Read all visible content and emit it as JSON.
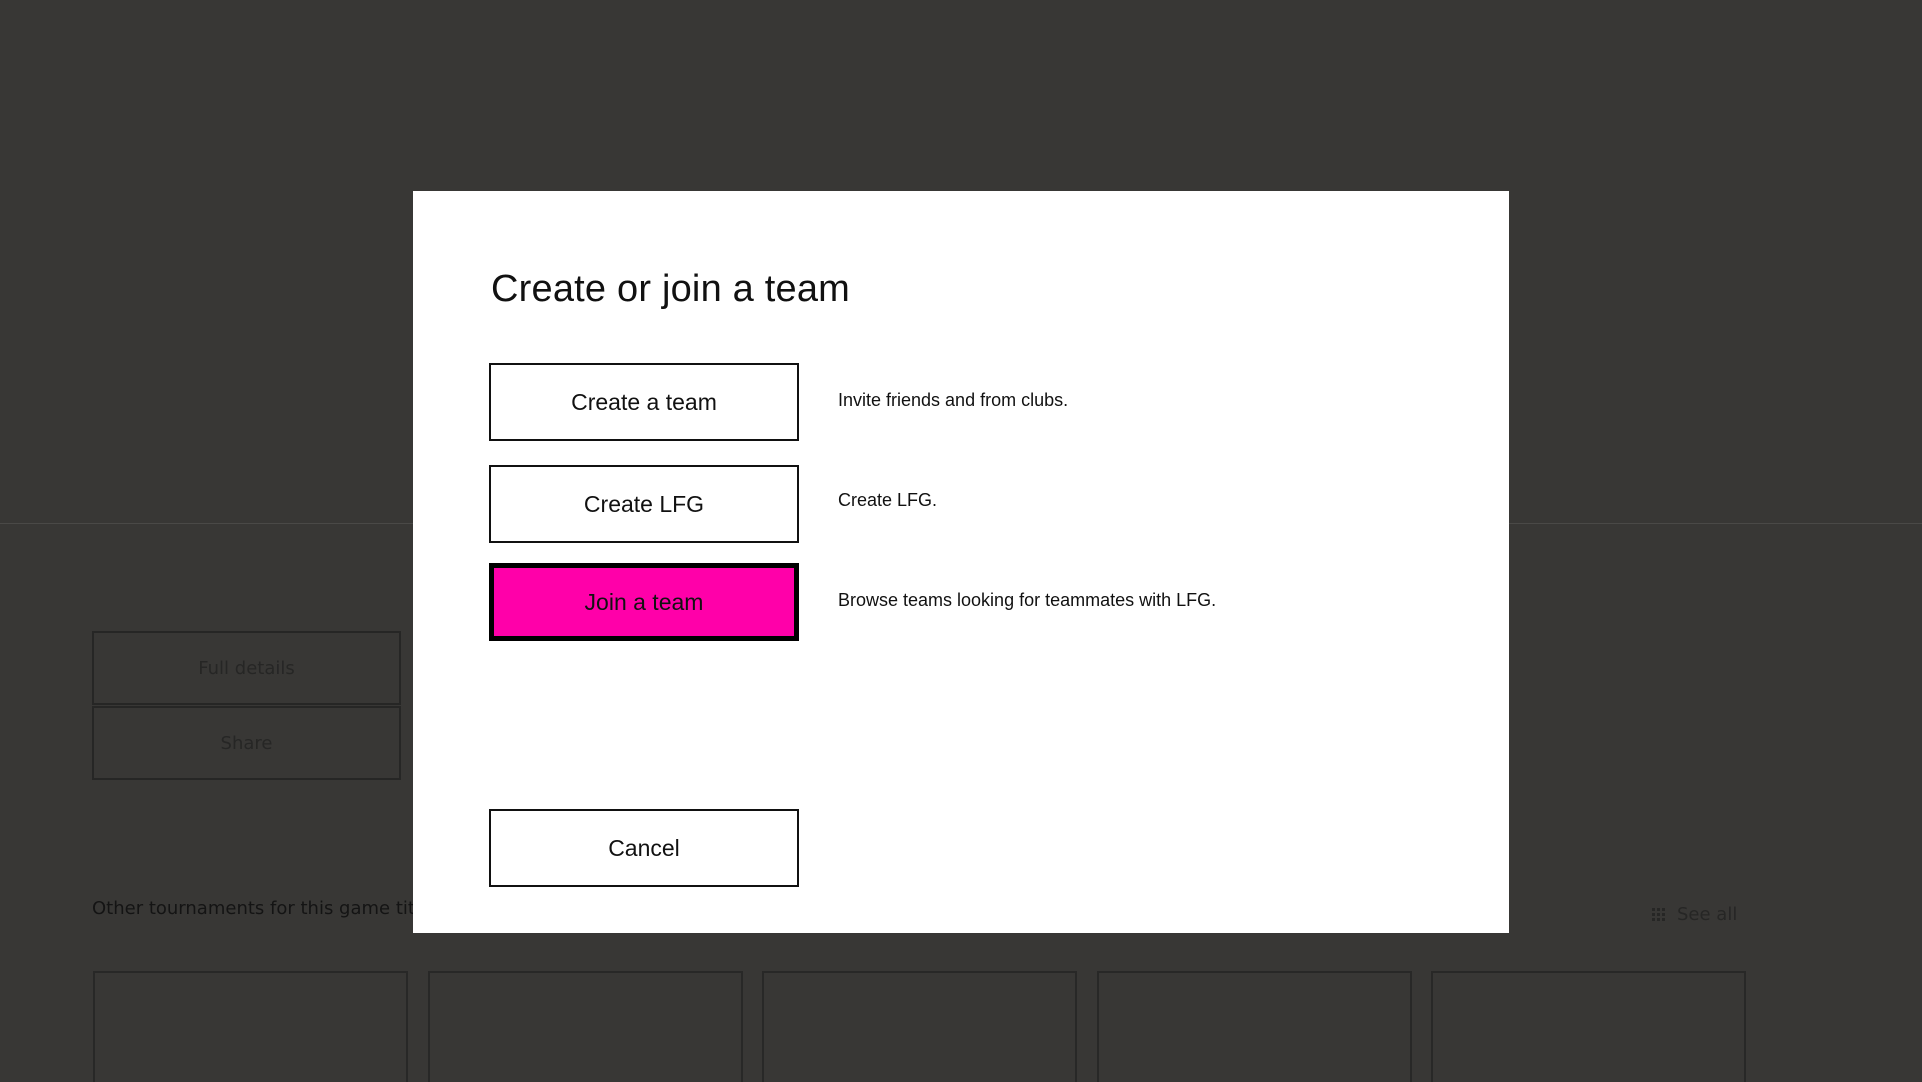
{
  "background": {
    "buttons": {
      "full_details": "Full details",
      "share": "Share"
    },
    "other_tournaments": {
      "title": "Other tournaments for this game title",
      "see_all": "See all",
      "see_all_icon": "grid-icon"
    }
  },
  "dialog": {
    "title": "Create or join a team",
    "options": [
      {
        "label": "Create a team",
        "description": "Invite friends and from clubs."
      },
      {
        "label": "Create LFG",
        "description": "Create LFG."
      },
      {
        "label": "Join a team",
        "description": "Browse teams looking for teammates with LFG."
      }
    ],
    "cancel_label": "Cancel"
  },
  "colors": {
    "backdrop": "#383735",
    "dialog_bg": "#ffffff",
    "focus_accent": "#ff00a9"
  }
}
